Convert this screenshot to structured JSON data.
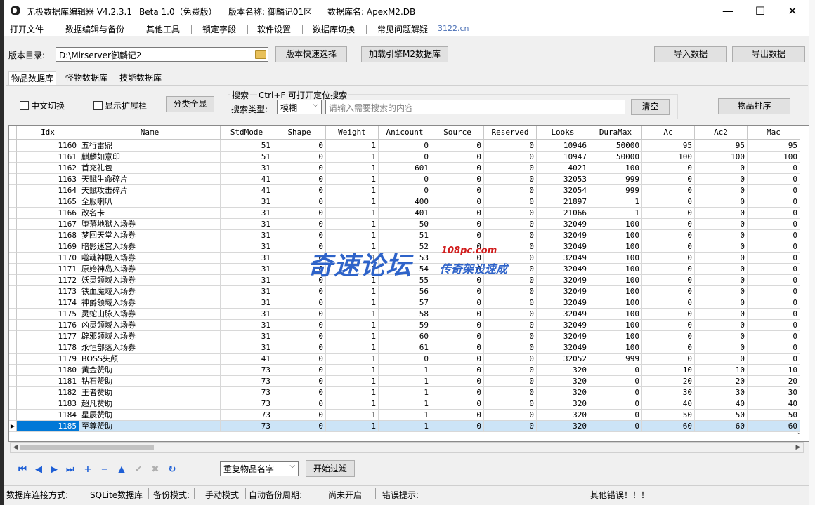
{
  "title": {
    "app": "无极数据库编辑器 V4.2.3.1",
    "edition": "Beta 1.0（免费版）",
    "version_name": "版本名称: 御麟记01区",
    "db_name": "数据库名: ApexM2.DB"
  },
  "window_controls": {
    "minimize": "—",
    "maximize": "☐",
    "close": "✕"
  },
  "menu": {
    "items": [
      "打开文件",
      "数据编辑与备份",
      "其他工具",
      "锁定字段",
      "软件设置",
      "数据库切换",
      "常见问题解疑"
    ],
    "link": "3122.cn"
  },
  "toolbar": {
    "dir_label": "版本目录:",
    "dir_value": "D:\\Mirserver御麟记2",
    "quick_select": "版本快速选择",
    "load_engine": "加载引擎M2数据库",
    "import": "导入数据",
    "export": "导出数据"
  },
  "tabs": [
    "物品数据库",
    "怪物数据库",
    "技能数据库"
  ],
  "filters": {
    "chinese_toggle": "中文切换",
    "show_ext": "显示扩展栏",
    "show_all": "分类全显",
    "search_title": "搜索",
    "search_hint": "Ctrl+F 可打开定位搜索",
    "search_type_label": "搜索类型:",
    "search_type_value": "模糊",
    "search_placeholder": "请输入需要搜索的内容",
    "clear": "清空",
    "sort": "物品排序"
  },
  "table": {
    "columns": [
      "Idx",
      "Name",
      "StdMode",
      "Shape",
      "Weight",
      "Anicount",
      "Source",
      "Reserved",
      "Looks",
      "DuraMax",
      "Ac",
      "Ac2",
      "Mac"
    ],
    "selected_row": 25,
    "rows": [
      [
        "1160",
        "五行雷鼎",
        "51",
        "0",
        "1",
        "0",
        "0",
        "0",
        "10946",
        "50000",
        "95",
        "95",
        "95"
      ],
      [
        "1161",
        "麒麟如意印",
        "51",
        "0",
        "1",
        "0",
        "0",
        "0",
        "10947",
        "50000",
        "100",
        "100",
        "100"
      ],
      [
        "1162",
        "首充礼包",
        "31",
        "0",
        "1",
        "601",
        "0",
        "0",
        "4021",
        "100",
        "0",
        "0",
        "0"
      ],
      [
        "1163",
        "天赋生命碎片",
        "41",
        "0",
        "1",
        "0",
        "0",
        "0",
        "32053",
        "999",
        "0",
        "0",
        "0"
      ],
      [
        "1164",
        "天赋攻击碎片",
        "41",
        "0",
        "1",
        "0",
        "0",
        "0",
        "32054",
        "999",
        "0",
        "0",
        "0"
      ],
      [
        "1165",
        "全服喇叭",
        "31",
        "0",
        "1",
        "400",
        "0",
        "0",
        "21897",
        "1",
        "0",
        "0",
        "0"
      ],
      [
        "1166",
        "改名卡",
        "31",
        "0",
        "1",
        "401",
        "0",
        "0",
        "21066",
        "1",
        "0",
        "0",
        "0"
      ],
      [
        "1167",
        "堕落地狱入场券",
        "31",
        "0",
        "1",
        "50",
        "0",
        "0",
        "32049",
        "100",
        "0",
        "0",
        "0"
      ],
      [
        "1168",
        "梦回天堂入场券",
        "31",
        "0",
        "1",
        "51",
        "0",
        "0",
        "32049",
        "100",
        "0",
        "0",
        "0"
      ],
      [
        "1169",
        "暗影迷宫入场券",
        "31",
        "0",
        "1",
        "52",
        "0",
        "0",
        "32049",
        "100",
        "0",
        "0",
        "0"
      ],
      [
        "1170",
        "噬魂神殿入场券",
        "31",
        "0",
        "1",
        "53",
        "0",
        "0",
        "32049",
        "100",
        "0",
        "0",
        "0"
      ],
      [
        "1171",
        "原始神岛入场券",
        "31",
        "0",
        "1",
        "54",
        "0",
        "0",
        "32049",
        "100",
        "0",
        "0",
        "0"
      ],
      [
        "1172",
        "妖灵领域入场券",
        "31",
        "0",
        "1",
        "55",
        "0",
        "0",
        "32049",
        "100",
        "0",
        "0",
        "0"
      ],
      [
        "1173",
        "铁血魔域入场券",
        "31",
        "0",
        "1",
        "56",
        "0",
        "0",
        "32049",
        "100",
        "0",
        "0",
        "0"
      ],
      [
        "1174",
        "神爵领域入场券",
        "31",
        "0",
        "1",
        "57",
        "0",
        "0",
        "32049",
        "100",
        "0",
        "0",
        "0"
      ],
      [
        "1175",
        "灵蛇山脉入场券",
        "31",
        "0",
        "1",
        "58",
        "0",
        "0",
        "32049",
        "100",
        "0",
        "0",
        "0"
      ],
      [
        "1176",
        "凶灵领域入场券",
        "31",
        "0",
        "1",
        "59",
        "0",
        "0",
        "32049",
        "100",
        "0",
        "0",
        "0"
      ],
      [
        "1177",
        "辟邪领域入场券",
        "31",
        "0",
        "1",
        "60",
        "0",
        "0",
        "32049",
        "100",
        "0",
        "0",
        "0"
      ],
      [
        "1178",
        "永恒部落入场券",
        "31",
        "0",
        "1",
        "61",
        "0",
        "0",
        "32049",
        "100",
        "0",
        "0",
        "0"
      ],
      [
        "1179",
        "BOSS头颅",
        "41",
        "0",
        "1",
        "0",
        "0",
        "0",
        "32052",
        "999",
        "0",
        "0",
        "0"
      ],
      [
        "1180",
        "黄金赞助",
        "73",
        "0",
        "1",
        "1",
        "0",
        "0",
        "320",
        "0",
        "10",
        "10",
        "10"
      ],
      [
        "1181",
        "钻石赞助",
        "73",
        "0",
        "1",
        "1",
        "0",
        "0",
        "320",
        "0",
        "20",
        "20",
        "20"
      ],
      [
        "1182",
        "王者赞助",
        "73",
        "0",
        "1",
        "1",
        "0",
        "0",
        "320",
        "0",
        "30",
        "30",
        "30"
      ],
      [
        "1183",
        "超凡赞助",
        "73",
        "0",
        "1",
        "1",
        "0",
        "0",
        "320",
        "0",
        "40",
        "40",
        "40"
      ],
      [
        "1184",
        "星辰赞助",
        "73",
        "0",
        "1",
        "1",
        "0",
        "0",
        "320",
        "0",
        "50",
        "50",
        "50"
      ],
      [
        "1185",
        "至尊赞助",
        "73",
        "0",
        "1",
        "1",
        "0",
        "0",
        "320",
        "0",
        "60",
        "60",
        "60"
      ]
    ]
  },
  "nav_icons": [
    "first-icon",
    "prev-icon",
    "next-icon",
    "last-icon",
    "add-icon",
    "delete-icon",
    "up-icon",
    "confirm-icon",
    "cancel-icon",
    "refresh-icon"
  ],
  "bottom": {
    "filter_value": "重复物品名字",
    "filter_button": "开始过滤"
  },
  "status": {
    "conn_label": "数据库连接方式:",
    "conn_value": "SQLite数据库",
    "backup_label": "备份模式:",
    "backup_value": "手动模式",
    "auto_label": "自动备份周期:",
    "auto_value": "尚未开启",
    "error_label": "错误提示:",
    "error_value": "其他错误！！！"
  },
  "watermark": {
    "main": "奇速论坛",
    "url": "108pc.com",
    "sub": "传奇架设速成"
  },
  "colors": {
    "selection": "#0078d7",
    "selection_row": "#cce4f7",
    "nav_icon": "#1e5fd6",
    "watermark_blue": "#2e63c9",
    "watermark_red": "#d11d1d"
  }
}
